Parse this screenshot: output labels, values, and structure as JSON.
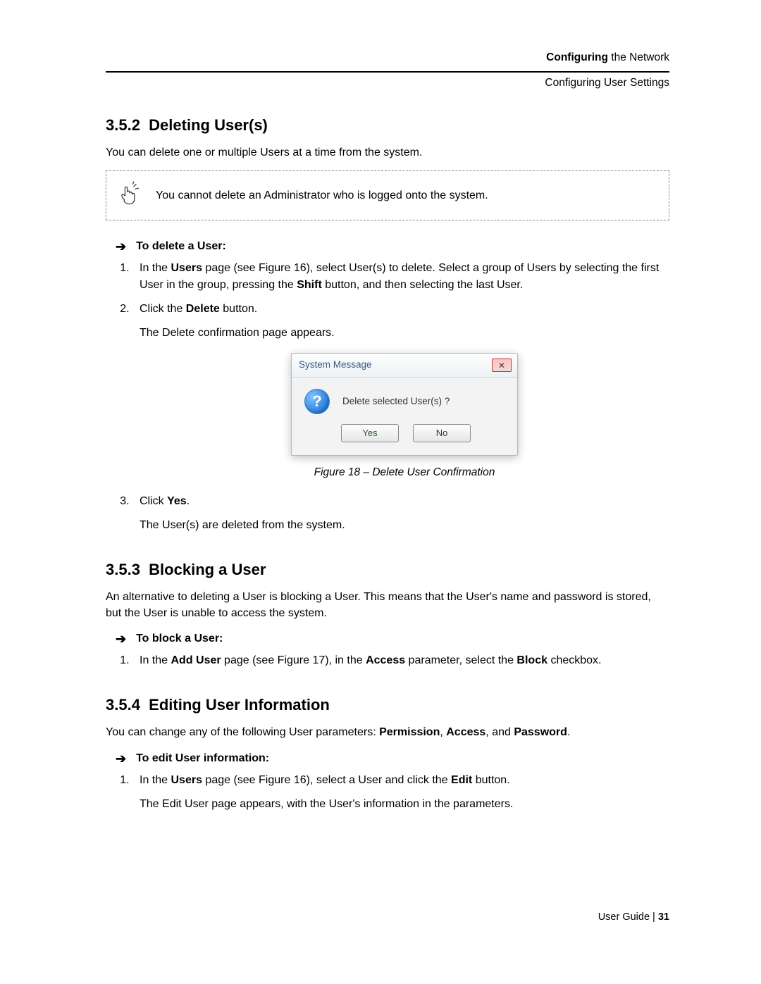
{
  "header": {
    "chapter_bold": "Configuring",
    "chapter_rest": " the Network",
    "subsection": "Configuring User Settings"
  },
  "s352": {
    "num": "3.5.2",
    "title": "Deleting User(s)",
    "intro": "You can delete one or multiple Users at a time from the system.",
    "note": "You cannot delete an Administrator who is logged onto the system.",
    "proc_title": "To delete a User:",
    "step1_a": "In the ",
    "step1_users": "Users",
    "step1_b": " page (see Figure 16), select User(s) to delete. Select a group of Users by selecting the first User in the group, pressing the ",
    "step1_shift": "Shift",
    "step1_c": " button, and then selecting the last User.",
    "step2_a": "Click the ",
    "step2_delete": "Delete",
    "step2_b": " button.",
    "step2_result": "The Delete confirmation page appears.",
    "step3_a": "Click ",
    "step3_yes": "Yes",
    "step3_b": ".",
    "step3_result": "The User(s) are deleted from the system."
  },
  "dialog": {
    "title": "System Message",
    "message": "Delete selected User(s) ?",
    "yes": "Yes",
    "no": "No",
    "caption": "Figure 18 – Delete User Confirmation"
  },
  "s353": {
    "num": "3.5.3",
    "title": "Blocking a User",
    "intro": "An alternative to deleting a User is blocking a User. This means that the User's name and password is stored, but the User is unable to access the system.",
    "proc_title": "To block a User:",
    "step1_a": "In the ",
    "step1_adduser": "Add User",
    "step1_b": " page (see Figure 17), in the ",
    "step1_access": "Access",
    "step1_c": " parameter, select the ",
    "step1_block": "Block",
    "step1_d": " checkbox."
  },
  "s354": {
    "num": "3.5.4",
    "title": "Editing User Information",
    "intro_a": "You can change any of the following User parameters: ",
    "perm": "Permission",
    "comma1": ", ",
    "access": "Access",
    "intro_b": ", and ",
    "password": "Password",
    "period": ".",
    "proc_title": "To edit User information:",
    "step1_a": "In the ",
    "step1_users": "Users",
    "step1_b": " page (see Figure 16), select a User and click the ",
    "step1_edit": "Edit",
    "step1_c": " button.",
    "step1_result": "The Edit User page appears, with the User's information in the parameters."
  },
  "footer": {
    "label": "User Guide | ",
    "page": "31"
  }
}
